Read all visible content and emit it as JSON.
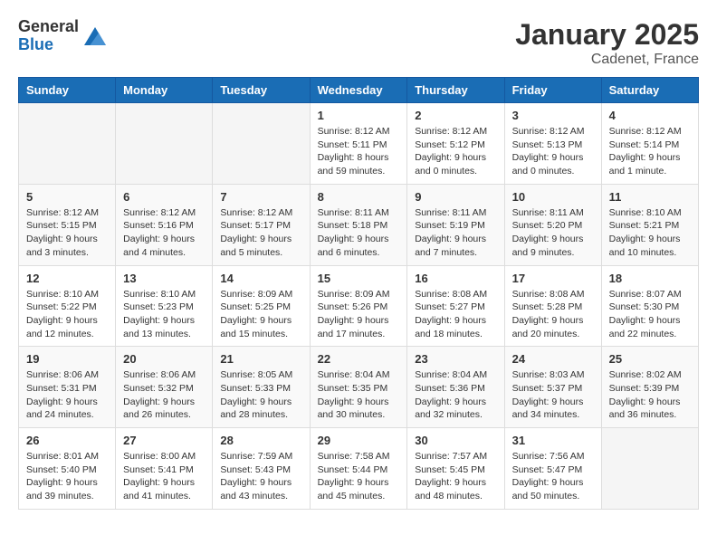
{
  "logo": {
    "general": "General",
    "blue": "Blue"
  },
  "header": {
    "month": "January 2025",
    "location": "Cadenet, France"
  },
  "weekdays": [
    "Sunday",
    "Monday",
    "Tuesday",
    "Wednesday",
    "Thursday",
    "Friday",
    "Saturday"
  ],
  "weeks": [
    [
      {
        "day": "",
        "info": ""
      },
      {
        "day": "",
        "info": ""
      },
      {
        "day": "",
        "info": ""
      },
      {
        "day": "1",
        "info": "Sunrise: 8:12 AM\nSunset: 5:11 PM\nDaylight: 8 hours\nand 59 minutes."
      },
      {
        "day": "2",
        "info": "Sunrise: 8:12 AM\nSunset: 5:12 PM\nDaylight: 9 hours\nand 0 minutes."
      },
      {
        "day": "3",
        "info": "Sunrise: 8:12 AM\nSunset: 5:13 PM\nDaylight: 9 hours\nand 0 minutes."
      },
      {
        "day": "4",
        "info": "Sunrise: 8:12 AM\nSunset: 5:14 PM\nDaylight: 9 hours\nand 1 minute."
      }
    ],
    [
      {
        "day": "5",
        "info": "Sunrise: 8:12 AM\nSunset: 5:15 PM\nDaylight: 9 hours\nand 3 minutes."
      },
      {
        "day": "6",
        "info": "Sunrise: 8:12 AM\nSunset: 5:16 PM\nDaylight: 9 hours\nand 4 minutes."
      },
      {
        "day": "7",
        "info": "Sunrise: 8:12 AM\nSunset: 5:17 PM\nDaylight: 9 hours\nand 5 minutes."
      },
      {
        "day": "8",
        "info": "Sunrise: 8:11 AM\nSunset: 5:18 PM\nDaylight: 9 hours\nand 6 minutes."
      },
      {
        "day": "9",
        "info": "Sunrise: 8:11 AM\nSunset: 5:19 PM\nDaylight: 9 hours\nand 7 minutes."
      },
      {
        "day": "10",
        "info": "Sunrise: 8:11 AM\nSunset: 5:20 PM\nDaylight: 9 hours\nand 9 minutes."
      },
      {
        "day": "11",
        "info": "Sunrise: 8:10 AM\nSunset: 5:21 PM\nDaylight: 9 hours\nand 10 minutes."
      }
    ],
    [
      {
        "day": "12",
        "info": "Sunrise: 8:10 AM\nSunset: 5:22 PM\nDaylight: 9 hours\nand 12 minutes."
      },
      {
        "day": "13",
        "info": "Sunrise: 8:10 AM\nSunset: 5:23 PM\nDaylight: 9 hours\nand 13 minutes."
      },
      {
        "day": "14",
        "info": "Sunrise: 8:09 AM\nSunset: 5:25 PM\nDaylight: 9 hours\nand 15 minutes."
      },
      {
        "day": "15",
        "info": "Sunrise: 8:09 AM\nSunset: 5:26 PM\nDaylight: 9 hours\nand 17 minutes."
      },
      {
        "day": "16",
        "info": "Sunrise: 8:08 AM\nSunset: 5:27 PM\nDaylight: 9 hours\nand 18 minutes."
      },
      {
        "day": "17",
        "info": "Sunrise: 8:08 AM\nSunset: 5:28 PM\nDaylight: 9 hours\nand 20 minutes."
      },
      {
        "day": "18",
        "info": "Sunrise: 8:07 AM\nSunset: 5:30 PM\nDaylight: 9 hours\nand 22 minutes."
      }
    ],
    [
      {
        "day": "19",
        "info": "Sunrise: 8:06 AM\nSunset: 5:31 PM\nDaylight: 9 hours\nand 24 minutes."
      },
      {
        "day": "20",
        "info": "Sunrise: 8:06 AM\nSunset: 5:32 PM\nDaylight: 9 hours\nand 26 minutes."
      },
      {
        "day": "21",
        "info": "Sunrise: 8:05 AM\nSunset: 5:33 PM\nDaylight: 9 hours\nand 28 minutes."
      },
      {
        "day": "22",
        "info": "Sunrise: 8:04 AM\nSunset: 5:35 PM\nDaylight: 9 hours\nand 30 minutes."
      },
      {
        "day": "23",
        "info": "Sunrise: 8:04 AM\nSunset: 5:36 PM\nDaylight: 9 hours\nand 32 minutes."
      },
      {
        "day": "24",
        "info": "Sunrise: 8:03 AM\nSunset: 5:37 PM\nDaylight: 9 hours\nand 34 minutes."
      },
      {
        "day": "25",
        "info": "Sunrise: 8:02 AM\nSunset: 5:39 PM\nDaylight: 9 hours\nand 36 minutes."
      }
    ],
    [
      {
        "day": "26",
        "info": "Sunrise: 8:01 AM\nSunset: 5:40 PM\nDaylight: 9 hours\nand 39 minutes."
      },
      {
        "day": "27",
        "info": "Sunrise: 8:00 AM\nSunset: 5:41 PM\nDaylight: 9 hours\nand 41 minutes."
      },
      {
        "day": "28",
        "info": "Sunrise: 7:59 AM\nSunset: 5:43 PM\nDaylight: 9 hours\nand 43 minutes."
      },
      {
        "day": "29",
        "info": "Sunrise: 7:58 AM\nSunset: 5:44 PM\nDaylight: 9 hours\nand 45 minutes."
      },
      {
        "day": "30",
        "info": "Sunrise: 7:57 AM\nSunset: 5:45 PM\nDaylight: 9 hours\nand 48 minutes."
      },
      {
        "day": "31",
        "info": "Sunrise: 7:56 AM\nSunset: 5:47 PM\nDaylight: 9 hours\nand 50 minutes."
      },
      {
        "day": "",
        "info": ""
      }
    ]
  ]
}
